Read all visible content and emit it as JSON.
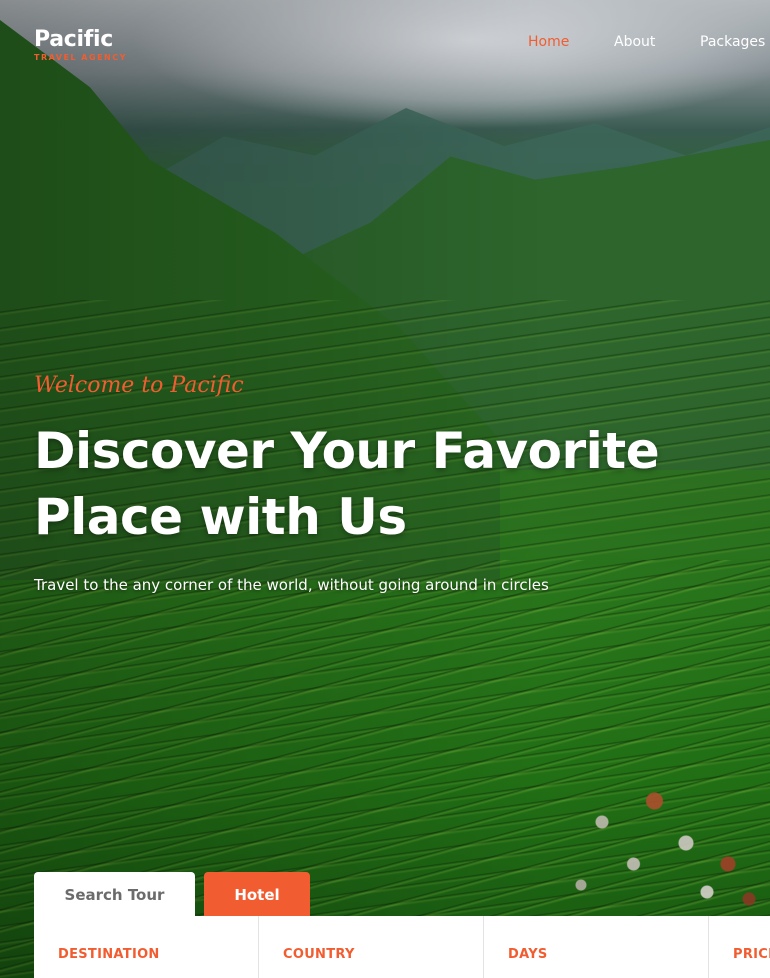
{
  "brand": {
    "name": "Pacific",
    "tagline": "TRAVEL AGENCY"
  },
  "nav": {
    "items": [
      {
        "label": "Home",
        "active": true
      },
      {
        "label": "About",
        "active": false
      },
      {
        "label": "Packages",
        "active": false
      }
    ]
  },
  "hero": {
    "welcome": "Welcome to Pacific",
    "headline_line1": "Discover Your Favorite",
    "headline_line2": "Place with Us",
    "subline": "Travel to the any corner of the world, without going around in circles"
  },
  "search": {
    "tabs": [
      {
        "label": "Search Tour",
        "active": true
      },
      {
        "label": "Hotel",
        "active": false
      }
    ],
    "fields": [
      {
        "label": "DESTINATION"
      },
      {
        "label": "COUNTRY"
      },
      {
        "label": "DAYS"
      },
      {
        "label": "PRICE"
      }
    ]
  },
  "colors": {
    "accent": "#f15d30",
    "text_light": "#ffffff",
    "tab_inactive_text": "#6b6b6b"
  }
}
